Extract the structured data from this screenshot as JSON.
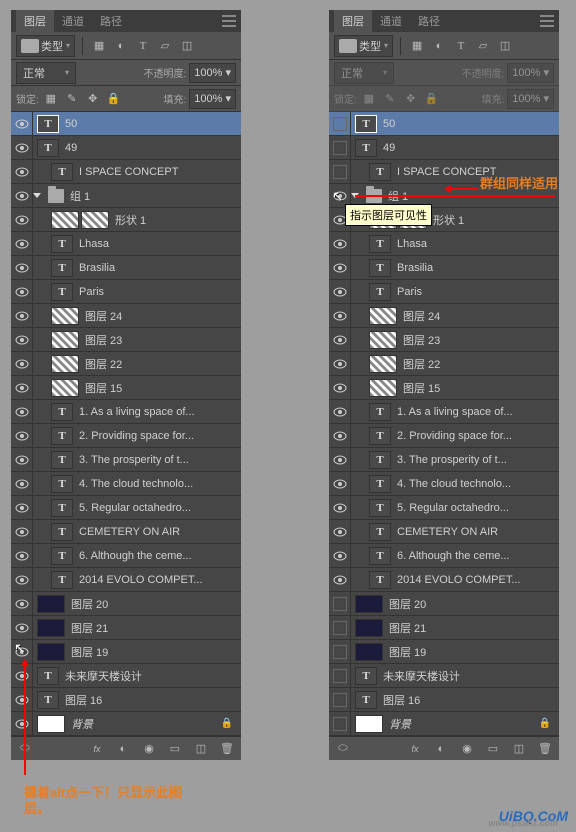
{
  "tabs": {
    "layers": "图层",
    "channels": "通道",
    "paths": "路径"
  },
  "filter": {
    "label": "类型"
  },
  "toolbar2": {
    "mode": "正常",
    "opacity_label": "不透明度:",
    "opacity": "100%",
    "lock_label": "锁定:",
    "fill_label": "填充:",
    "fill": "100%"
  },
  "annotations": {
    "left": "摁着alt点一下！只显示此图层。",
    "right": "群组同样适用",
    "tooltip": "指示图层可见性"
  },
  "watermark": {
    "main": "UiBQ.CoM",
    "sub": "www.psahz.com"
  },
  "layers_left": [
    {
      "type": "T",
      "name": "50",
      "sel": true,
      "eye": "on"
    },
    {
      "type": "T",
      "name": "49",
      "eye": "on"
    },
    {
      "type": "T",
      "name": "I   SPACE CONCEPT",
      "eye": "on",
      "indent": 1
    },
    {
      "type": "group",
      "name": "组 1",
      "eye": "on",
      "open": true
    },
    {
      "type": "shape",
      "name": "形状 1",
      "eye": "on",
      "indent": 1
    },
    {
      "type": "T",
      "name": "Lhasa",
      "eye": "on",
      "indent": 1
    },
    {
      "type": "T",
      "name": "Brasilia",
      "eye": "on",
      "indent": 1
    },
    {
      "type": "T",
      "name": "Paris",
      "eye": "on",
      "indent": 1
    },
    {
      "type": "img",
      "name": "图层 24",
      "eye": "on",
      "indent": 1
    },
    {
      "type": "img",
      "name": "图层 23",
      "eye": "on",
      "indent": 1
    },
    {
      "type": "img",
      "name": "图层 22",
      "eye": "on",
      "indent": 1
    },
    {
      "type": "img",
      "name": "图层 15",
      "eye": "on",
      "indent": 1
    },
    {
      "type": "T",
      "name": "1. As a living space of...",
      "eye": "on",
      "indent": 1
    },
    {
      "type": "T",
      "name": "2. Providing space for...",
      "eye": "on",
      "indent": 1
    },
    {
      "type": "T",
      "name": "3. The prosperity of t...",
      "eye": "on",
      "indent": 1
    },
    {
      "type": "T",
      "name": "4. The cloud technolo...",
      "eye": "on",
      "indent": 1
    },
    {
      "type": "T",
      "name": "5. Regular octahedro...",
      "eye": "on",
      "indent": 1
    },
    {
      "type": "T",
      "name": "CEMETERY ON AIR",
      "eye": "on",
      "indent": 1
    },
    {
      "type": "T",
      "name": "6. Although the ceme...",
      "eye": "on",
      "indent": 1
    },
    {
      "type": "T",
      "name": "2014 EVOLO COMPET...",
      "eye": "on",
      "indent": 1
    },
    {
      "type": "dark",
      "name": "图层 20",
      "eye": "cursor"
    },
    {
      "type": "dark",
      "name": "图层 21",
      "eye": "on"
    },
    {
      "type": "dark",
      "name": "图层 19",
      "eye": "on"
    },
    {
      "type": "T",
      "name": "未来摩天楼设计",
      "eye": "on"
    },
    {
      "type": "T",
      "name": "图层 16",
      "eye": "on"
    },
    {
      "type": "white",
      "name": "背景",
      "eye": "on",
      "italic": true,
      "locked": true
    }
  ],
  "layers_right": [
    {
      "type": "T",
      "name": "50",
      "sel": true,
      "eye": "box"
    },
    {
      "type": "T",
      "name": "49",
      "eye": "box"
    },
    {
      "type": "T",
      "name": "I   SPACE CONCEPT",
      "eye": "box",
      "indent": 1
    },
    {
      "type": "group",
      "name": "组 1",
      "eye": "cursor",
      "open": true,
      "redline": true
    },
    {
      "type": "shape",
      "name": "形状 1",
      "eye": "on",
      "indent": 1,
      "tooltip": true
    },
    {
      "type": "T",
      "name": "Lhasa",
      "eye": "on",
      "indent": 1
    },
    {
      "type": "T",
      "name": "Brasilia",
      "eye": "on",
      "indent": 1
    },
    {
      "type": "T",
      "name": "Paris",
      "eye": "on",
      "indent": 1
    },
    {
      "type": "img",
      "name": "图层 24",
      "eye": "on",
      "indent": 1
    },
    {
      "type": "img",
      "name": "图层 23",
      "eye": "on",
      "indent": 1
    },
    {
      "type": "img",
      "name": "图层 22",
      "eye": "on",
      "indent": 1
    },
    {
      "type": "img",
      "name": "图层 15",
      "eye": "on",
      "indent": 1
    },
    {
      "type": "T",
      "name": "1. As a living space of...",
      "eye": "on",
      "indent": 1
    },
    {
      "type": "T",
      "name": "2. Providing space for...",
      "eye": "on",
      "indent": 1
    },
    {
      "type": "T",
      "name": "3. The prosperity of t...",
      "eye": "on",
      "indent": 1
    },
    {
      "type": "T",
      "name": "4. The cloud technolo...",
      "eye": "on",
      "indent": 1
    },
    {
      "type": "T",
      "name": "5. Regular octahedro...",
      "eye": "on",
      "indent": 1
    },
    {
      "type": "T",
      "name": "CEMETERY ON AIR",
      "eye": "on",
      "indent": 1
    },
    {
      "type": "T",
      "name": "6. Although the ceme...",
      "eye": "on",
      "indent": 1
    },
    {
      "type": "T",
      "name": "2014 EVOLO COMPET...",
      "eye": "on",
      "indent": 1
    },
    {
      "type": "dark",
      "name": "图层 20",
      "eye": "box"
    },
    {
      "type": "dark",
      "name": "图层 21",
      "eye": "box"
    },
    {
      "type": "dark",
      "name": "图层 19",
      "eye": "box"
    },
    {
      "type": "T",
      "name": "未来摩天楼设计",
      "eye": "box"
    },
    {
      "type": "T",
      "name": "图层 16",
      "eye": "box"
    },
    {
      "type": "white",
      "name": "背景",
      "eye": "box",
      "italic": true,
      "locked": true
    }
  ]
}
